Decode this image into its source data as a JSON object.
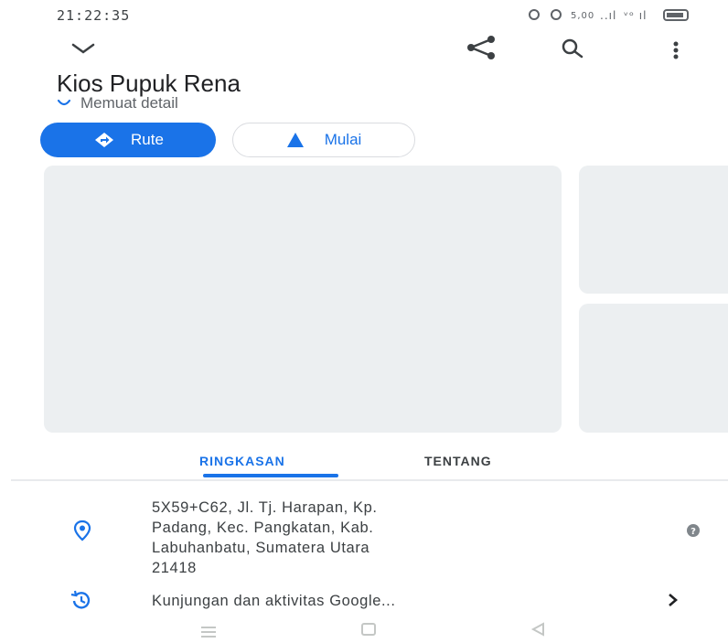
{
  "status_bar": {
    "time": "21:22:35",
    "indicators": "⊙ ◎ ᵏᵇ ..∣l ᵗᵗ∣l ▭"
  },
  "toolbar": {
    "collapse_icon": "chevron-down-icon",
    "share_icon": "share-icon",
    "search_icon": "search-icon",
    "more_icon": "more-vert-icon"
  },
  "place": {
    "title": "Kios Pupuk Rena",
    "loading_text": "Memuat detail"
  },
  "actions": {
    "route_label": "Rute",
    "start_label": "Mulai",
    "accent": "#1a73e8"
  },
  "tabs": [
    {
      "label": "RINGKASAN",
      "active": true
    },
    {
      "label": "TENTANG",
      "active": false
    }
  ],
  "details": {
    "address_lines": [
      "5X59+C62, Jl. Tj. Harapan, Kp.",
      "Padang, Kec. Pangkatan, Kab.",
      "Labuhanbatu, Sumatera Utara",
      "21418"
    ],
    "visits_label": "Kunjungan dan aktivitas Google..."
  }
}
